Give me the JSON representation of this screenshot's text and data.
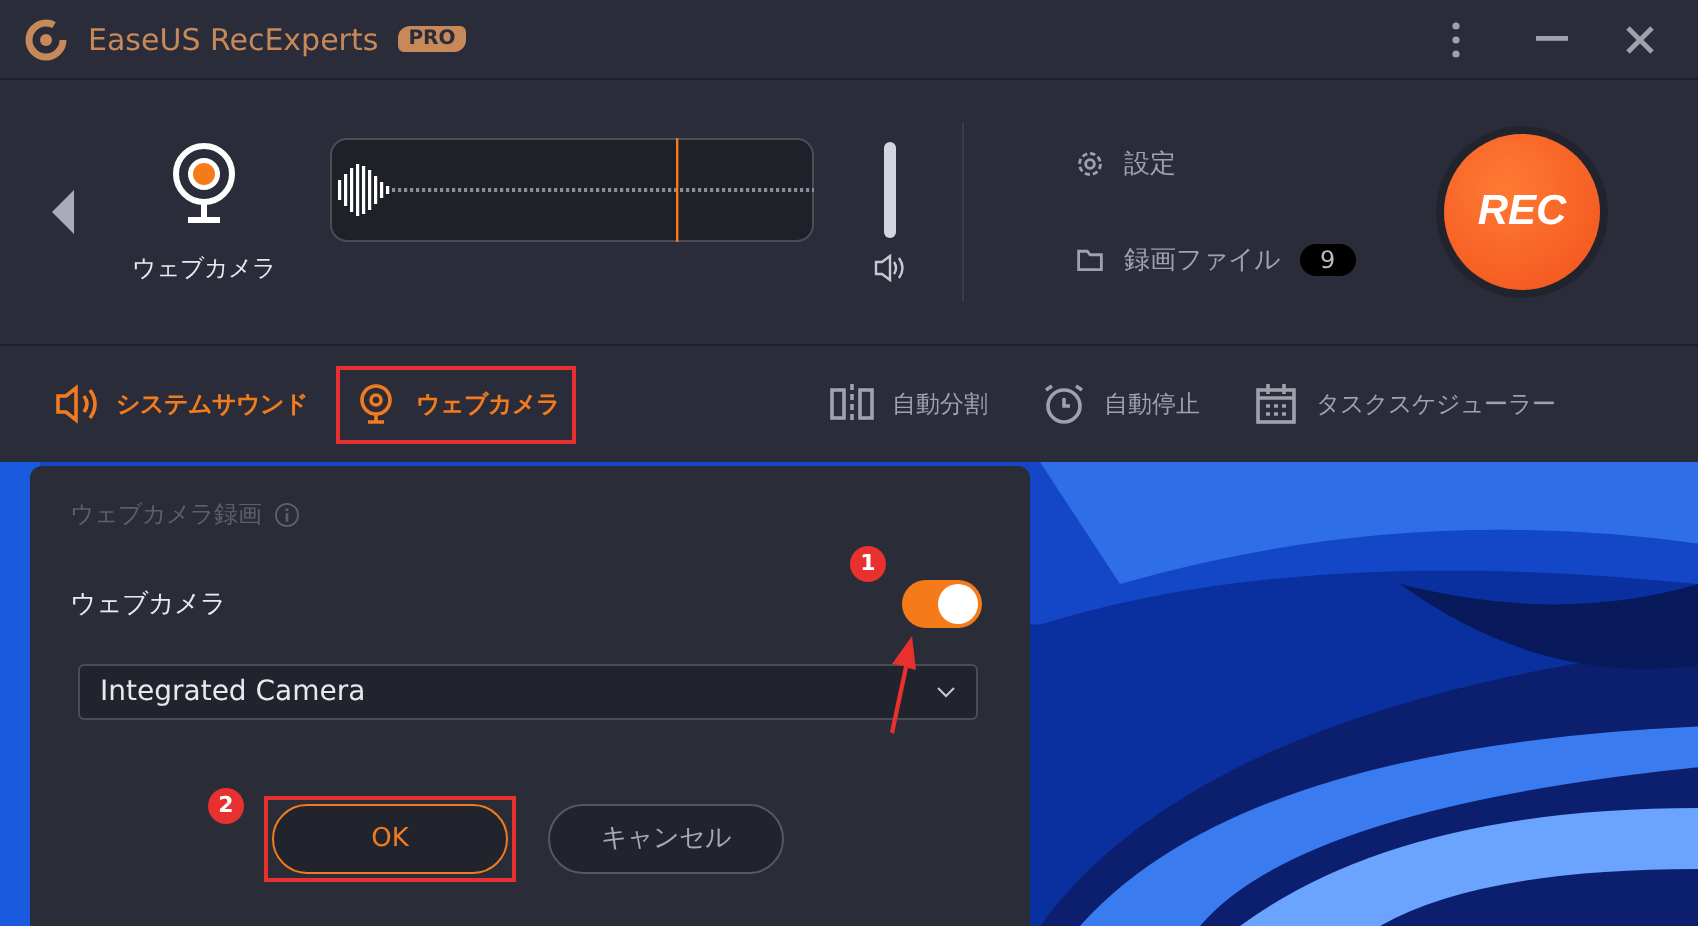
{
  "window": {
    "title": "EaseUS RecExperts",
    "badge": "PRO"
  },
  "source": {
    "label": "ウェブカメラ"
  },
  "volume": {
    "level": 1
  },
  "side_links": [
    {
      "kind": "settings",
      "label": "設定"
    },
    {
      "kind": "files",
      "label": "録画ファイル",
      "count": "9"
    }
  ],
  "rec_button": "REC",
  "toolbar": [
    {
      "kind": "sound",
      "label": "システムサウンド",
      "on": true,
      "highlighted": false
    },
    {
      "kind": "webcam",
      "label": "ウェブカメラ",
      "on": true,
      "highlighted": true
    },
    {
      "kind": "split",
      "label": "自動分割",
      "on": false,
      "highlighted": false
    },
    {
      "kind": "stop",
      "label": "自動停止",
      "on": false,
      "highlighted": false
    },
    {
      "kind": "schedule",
      "label": "タスクスケジューラー",
      "on": false,
      "highlighted": false
    }
  ],
  "dialog": {
    "title": "ウェブカメラ録画",
    "toggle_label": "ウェブカメラ",
    "toggle_on": true,
    "toggle_callout": "1",
    "camera": "Integrated Camera",
    "ok": "OK",
    "ok_highlighted": true,
    "ok_callout": "2",
    "cancel": "キャンセル"
  }
}
